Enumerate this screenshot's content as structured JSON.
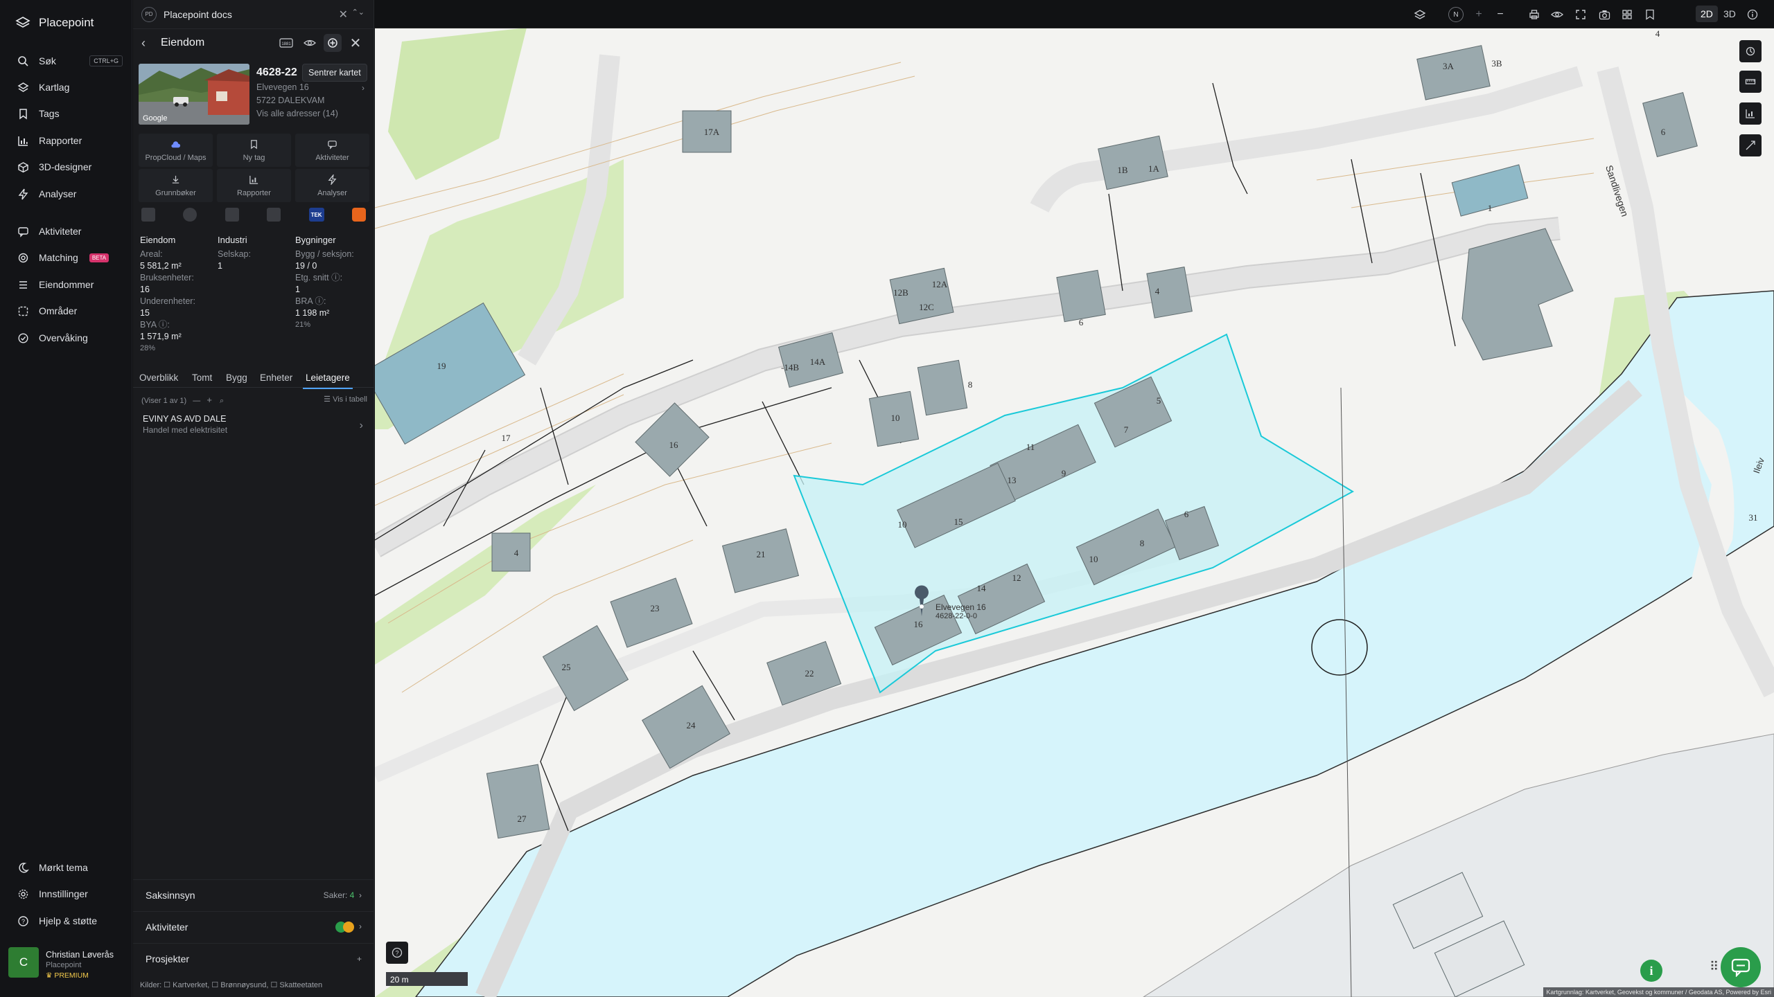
{
  "nav": {
    "brand": "Placepoint",
    "items": [
      {
        "label": "Søk",
        "shortcut": "CTRL+G"
      },
      {
        "label": "Kartlag"
      },
      {
        "label": "Tags"
      },
      {
        "label": "Rapporter"
      },
      {
        "label": "3D-designer"
      },
      {
        "label": "Analyser"
      },
      {
        "label": "Aktiviteter"
      },
      {
        "label": "Matching",
        "badge": "BETA"
      },
      {
        "label": "Eiendommer"
      },
      {
        "label": "Områder"
      },
      {
        "label": "Overvåking"
      }
    ],
    "bottom": [
      {
        "label": "Mørkt tema"
      },
      {
        "label": "Innstillinger"
      },
      {
        "label": "Hjelp & støtte"
      }
    ],
    "user": {
      "initial": "C",
      "name": "Christian Løverås",
      "company": "Placepoint",
      "plan": "PREMIUM"
    }
  },
  "panel": {
    "header": {
      "logo": "PD",
      "title": "Placepoint docs"
    },
    "sub_title": "Eiendom",
    "tooltip": "Sentrer kartet",
    "property": {
      "id": "4628-22",
      "address": "Elvevegen 16",
      "postal": "5722 DALEKVAM",
      "all_addresses": "Vis alle adresser (14)",
      "photo_credit": "Google"
    },
    "actions": [
      "PropCloud / Maps",
      "Ny tag",
      "Aktiviteter",
      "Grunnbøker",
      "Rapporter",
      "Analyser"
    ],
    "tek_label": "TEK",
    "stats": {
      "col1_header": "Eiendom",
      "col2_header": "Industri",
      "col3_header": "Bygninger",
      "areal_k": "Areal:",
      "areal_v": "5 581,2 m²",
      "bruks_k": "Bruksenheter:",
      "bruks_v": "16",
      "under_k": "Underenheter:",
      "under_v": "15",
      "bya_k": "BYA ⓘ:",
      "bya_v": "1 571,9 m²",
      "bya_p": "28%",
      "selskap_k": "Selskap:",
      "selskap_v": "1",
      "bygg_k": "Bygg / seksjon:",
      "bygg_v": "19 / 0",
      "etg_k": "Etg. snitt ⓘ:",
      "etg_v": "1",
      "bra_k": "BRA ⓘ:",
      "bra_v": "1 198 m²",
      "bra_p": "21%"
    },
    "tabs": [
      "Overblikk",
      "Tomt",
      "Bygg",
      "Enheter",
      "Leietagere"
    ],
    "pager": "(Viser 1 av 1)",
    "table_toggle": "Vis i tabell",
    "tenant": {
      "name": "EVINY AS AVD DALE",
      "desc": "Handel med elektrisitet"
    },
    "sections": {
      "saksinnsyn": "Saksinnsyn",
      "saker_label": "Saker:",
      "saker_count": "4",
      "aktiviteter": "Aktiviteter",
      "prosjekter": "Prosjekter"
    },
    "sources": "Kilder: ☐ Kartverket, ☐ Brønnøysund, ☐ Skatteetaten"
  },
  "topbar": {
    "mode_2d": "2D",
    "mode_3d": "3D",
    "north": "N"
  },
  "map": {
    "street": "Sandlivegen",
    "street2": "Ileiv",
    "marker_address": "Elvevegen 16",
    "marker_id": "4628-22-0-0",
    "scale": "20 m",
    "credit": "Kartgrunnlag: Kartverket, Geovekst og kommuner / Geodata AS, Powered by Esri",
    "house_labels": [
      "3A",
      "3B",
      "17A",
      "1B",
      "1A",
      "1",
      "6",
      "12B",
      "12A",
      "12C",
      "4",
      "6",
      "-14B",
      "14A",
      "8",
      "10",
      "5",
      "7",
      "16",
      "11",
      "9",
      "13",
      "10",
      "15",
      "6",
      "8",
      "10",
      "12",
      "14",
      "16",
      "21",
      "23",
      "22",
      "24",
      "25",
      "27",
      "4",
      "19",
      "17",
      "31",
      "4"
    ]
  },
  "colors": {
    "accent": "#4fa3ff",
    "green": "#2a9d4b",
    "highlight": "#19c9d8",
    "water": "#d6f4fb",
    "building": "#9aa9ad",
    "beta": "#d6336c"
  }
}
